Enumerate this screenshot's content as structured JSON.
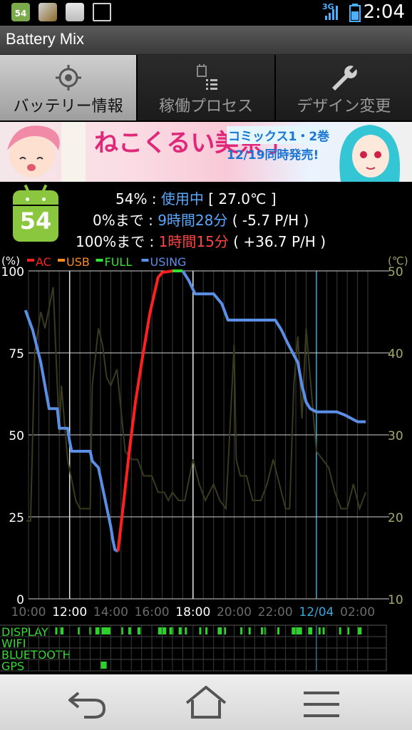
{
  "status": {
    "network": "3G",
    "time": "2:04",
    "battery_icon_text": "54"
  },
  "app": {
    "title": "Battery Mix"
  },
  "tabs": [
    {
      "label": "バッテリー情報",
      "icon": "crosshair-icon",
      "active": true
    },
    {
      "label": "稼働プロセス",
      "icon": "process-list-icon",
      "active": false
    },
    {
      "label": "デザイン変更",
      "icon": "wrench-icon",
      "active": false
    }
  ],
  "banner": {
    "title": "ねこくるい美奈子",
    "line1": "コミックス1・2巻",
    "line2": "12/19同時発売!"
  },
  "battery": {
    "level": "54",
    "percent": "54%",
    "sep1": " : ",
    "status": "使用中",
    "temp": "[ 27.0℃ ]",
    "to_empty_label": "0%まで : ",
    "to_empty_time": "9時間28分",
    "to_empty_rate": "( -5.7 P/H )",
    "to_full_label": "100%まで : ",
    "to_full_time": "1時間15分",
    "to_full_rate": "( +36.7 P/H )"
  },
  "chart_data": {
    "type": "line",
    "ylabel_left": "(%)",
    "ylabel_right": "(℃)",
    "legend": [
      {
        "name": "AC",
        "color": "#ff2020"
      },
      {
        "name": "USB",
        "color": "#ff8a1e"
      },
      {
        "name": "FULL",
        "color": "#35e035"
      },
      {
        "name": "USING",
        "color": "#5b8fe6"
      }
    ],
    "y_ticks_left": [
      {
        "value": 100,
        "label": "100"
      },
      {
        "value": 75,
        "label": "75"
      },
      {
        "value": 50,
        "label": "50"
      },
      {
        "value": 25,
        "label": "25"
      },
      {
        "value": 0,
        "label": "0"
      }
    ],
    "y_ticks_right": [
      {
        "value": 50,
        "label": "50"
      },
      {
        "value": 40,
        "label": "40"
      },
      {
        "value": 30,
        "label": "30"
      },
      {
        "value": 20,
        "label": "20"
      },
      {
        "value": 10,
        "label": "10"
      }
    ],
    "x_ticks": [
      {
        "h": 10,
        "label": "10:00",
        "style": "dim"
      },
      {
        "h": 12,
        "label": "12:00",
        "style": "bright"
      },
      {
        "h": 14,
        "label": "14:00",
        "style": "dim"
      },
      {
        "h": 16,
        "label": "16:00",
        "style": "dim"
      },
      {
        "h": 18,
        "label": "18:00",
        "style": "bright"
      },
      {
        "h": 20,
        "label": "20:00",
        "style": "dim"
      },
      {
        "h": 22,
        "label": "22:00",
        "style": "dim"
      },
      {
        "h": 24,
        "label": "12/04",
        "style": "date"
      },
      {
        "h": 26,
        "label": "02:00",
        "style": "dim"
      }
    ],
    "x_range_hours": [
      10,
      26.5
    ],
    "y_range_left": [
      0,
      100
    ],
    "y_range_right": [
      10,
      50
    ],
    "series": [
      {
        "name": "USING",
        "points": [
          [
            9.85,
            88
          ],
          [
            10.2,
            82
          ],
          [
            10.6,
            72
          ],
          [
            11.0,
            58
          ],
          [
            11.4,
            58
          ],
          [
            11.5,
            52
          ],
          [
            11.9,
            52
          ],
          [
            12.0,
            48
          ],
          [
            12.1,
            45
          ],
          [
            13.0,
            45
          ],
          [
            13.1,
            42
          ],
          [
            13.4,
            40
          ],
          [
            13.5,
            37
          ],
          [
            13.9,
            25
          ],
          [
            14.0,
            22
          ],
          [
            14.1,
            18
          ],
          [
            14.2,
            15
          ],
          [
            14.35,
            14.5
          ]
        ]
      },
      {
        "name": "AC",
        "points": [
          [
            14.35,
            14.5
          ],
          [
            14.6,
            28
          ],
          [
            14.9,
            45
          ],
          [
            15.2,
            60
          ],
          [
            15.5,
            72
          ],
          [
            15.9,
            87
          ],
          [
            16.3,
            98
          ],
          [
            16.5,
            99.5
          ],
          [
            17.0,
            100
          ]
        ]
      },
      {
        "name": "FULL",
        "points": [
          [
            17.0,
            100
          ],
          [
            17.5,
            100
          ]
        ]
      },
      {
        "name": "USING",
        "points": [
          [
            17.5,
            100
          ],
          [
            17.8,
            97
          ],
          [
            18.1,
            93
          ],
          [
            18.5,
            93
          ],
          [
            19.0,
            93
          ],
          [
            19.4,
            90
          ],
          [
            19.7,
            85
          ],
          [
            22.0,
            85
          ],
          [
            22.3,
            82
          ],
          [
            22.6,
            78
          ],
          [
            23.1,
            72
          ],
          [
            23.3,
            65
          ],
          [
            23.5,
            60
          ],
          [
            23.7,
            58
          ],
          [
            24.0,
            57
          ],
          [
            25.0,
            57
          ],
          [
            25.4,
            56
          ],
          [
            26.0,
            54
          ],
          [
            26.4,
            54
          ]
        ]
      }
    ],
    "temperature": [
      [
        9.9,
        19.5
      ],
      [
        10.1,
        19.5
      ],
      [
        10.3,
        40
      ],
      [
        10.6,
        45
      ],
      [
        10.8,
        43
      ],
      [
        11.2,
        48
      ],
      [
        11.5,
        30
      ],
      [
        11.6,
        36
      ],
      [
        11.9,
        27
      ],
      [
        12.3,
        22
      ],
      [
        12.5,
        21
      ],
      [
        13.0,
        21
      ],
      [
        13.1,
        36
      ],
      [
        13.4,
        43
      ],
      [
        13.6,
        41
      ],
      [
        13.8,
        37
      ],
      [
        14.0,
        36
      ],
      [
        14.3,
        38
      ],
      [
        14.7,
        28
      ],
      [
        15.0,
        27
      ],
      [
        15.3,
        27
      ],
      [
        15.6,
        25
      ],
      [
        16.0,
        25
      ],
      [
        16.3,
        23
      ],
      [
        16.6,
        23
      ],
      [
        16.8,
        22
      ],
      [
        17.0,
        23
      ],
      [
        17.3,
        22
      ],
      [
        17.6,
        22
      ],
      [
        18.0,
        27
      ],
      [
        18.3,
        24
      ],
      [
        18.6,
        22
      ],
      [
        19.0,
        24
      ],
      [
        19.3,
        22
      ],
      [
        19.6,
        21
      ],
      [
        20.0,
        41
      ],
      [
        20.1,
        27
      ],
      [
        20.3,
        25
      ],
      [
        20.6,
        25
      ],
      [
        20.9,
        22
      ],
      [
        21.3,
        22
      ],
      [
        21.6,
        24
      ],
      [
        21.9,
        27
      ],
      [
        22.3,
        23
      ],
      [
        22.5,
        21
      ],
      [
        22.7,
        21
      ],
      [
        22.9,
        36
      ],
      [
        23.1,
        42
      ],
      [
        23.3,
        32
      ],
      [
        23.5,
        43
      ],
      [
        23.8,
        34
      ],
      [
        24.0,
        28
      ],
      [
        24.3,
        27
      ],
      [
        24.6,
        26
      ],
      [
        24.9,
        23
      ],
      [
        25.2,
        21
      ],
      [
        25.5,
        21
      ],
      [
        25.8,
        24
      ],
      [
        26.1,
        21
      ],
      [
        26.4,
        23
      ]
    ],
    "activity": [
      {
        "name": "DISPLAY",
        "segments": [
          [
            11.3,
            11.4
          ],
          [
            11.55,
            11.7
          ],
          [
            12.4,
            12.5
          ],
          [
            12.95,
            13.05
          ],
          [
            13.25,
            13.45
          ],
          [
            13.55,
            14.0
          ],
          [
            14.5,
            14.6
          ],
          [
            14.85,
            15.0
          ],
          [
            15.3,
            15.45
          ],
          [
            16.3,
            16.7
          ],
          [
            16.85,
            17.05
          ],
          [
            17.3,
            17.45
          ],
          [
            17.6,
            17.65
          ],
          [
            18.3,
            18.4
          ],
          [
            18.6,
            18.7
          ],
          [
            19.2,
            19.4
          ],
          [
            19.5,
            19.6
          ],
          [
            20.3,
            20.4
          ],
          [
            20.7,
            20.8
          ],
          [
            21.3,
            21.35
          ],
          [
            21.45,
            21.5
          ],
          [
            22.1,
            22.2
          ],
          [
            22.8,
            23.3
          ],
          [
            23.6,
            23.8
          ],
          [
            24.1,
            24.2
          ],
          [
            24.3,
            24.4
          ],
          [
            25.1,
            25.2
          ],
          [
            25.5,
            25.6
          ],
          [
            26.0,
            26.2
          ]
        ]
      },
      {
        "name": "WIFI",
        "segments": []
      },
      {
        "name": "BLUETOOTH",
        "segments": []
      },
      {
        "name": "GPS",
        "segments": [
          [
            13.5,
            13.8
          ]
        ]
      }
    ]
  },
  "nav": [
    {
      "name": "back",
      "icon": "back-icon"
    },
    {
      "name": "home",
      "icon": "home-icon"
    },
    {
      "name": "menu",
      "icon": "menu-icon"
    }
  ]
}
